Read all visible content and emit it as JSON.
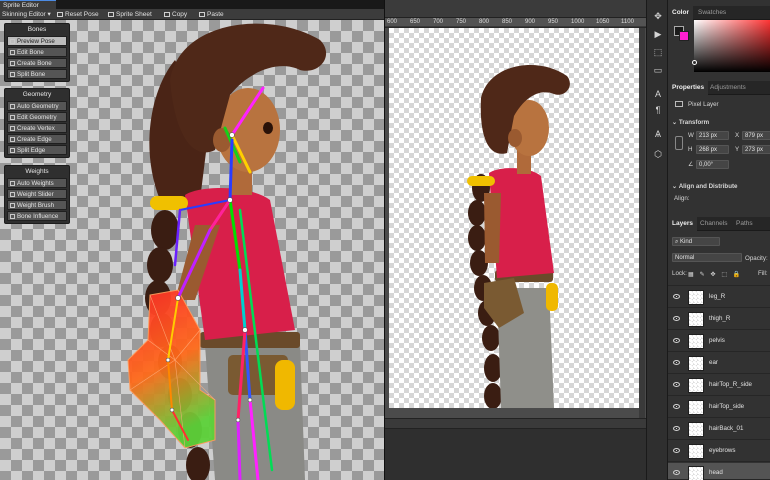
{
  "unity": {
    "window_tab": "Sprite Editor",
    "toolbar": {
      "mode_dropdown": "Skinning Editor",
      "reset_pose": "Reset Pose",
      "sprite_sheet": "Sprite Sheet",
      "copy": "Copy",
      "paste": "Paste"
    },
    "panels": [
      {
        "title": "Bones",
        "buttons": [
          "Preview Pose",
          "Edit Bone",
          "Create Bone",
          "Split Bone"
        ],
        "active": 0
      },
      {
        "title": "Geometry",
        "buttons": [
          "Auto Geometry",
          "Edit Geometry",
          "Create Vertex",
          "Create Edge",
          "Split Edge"
        ],
        "active": -1
      },
      {
        "title": "Weights",
        "buttons": [
          "Auto Weights",
          "Weight Slider",
          "Weight Brush",
          "Bone Influence"
        ],
        "active": -1
      }
    ]
  },
  "ps": {
    "ruler_ticks": [
      "600",
      "650",
      "700",
      "750",
      "800",
      "850",
      "900",
      "950",
      "1000",
      "1050",
      "1100"
    ],
    "tools": [
      "✥",
      "▶",
      "⬚",
      "▭",
      "A",
      "¶",
      "⊞",
      "Ѧ",
      "⬡"
    ],
    "color_tabs": [
      "Color",
      "Swatches"
    ],
    "fg_color": "#1a1a1a",
    "bg_color": "#ff1fd0",
    "properties_tabs": [
      "Properties",
      "Adjustments"
    ],
    "layer_kind": "Pixel Layer",
    "transform_title": "Transform",
    "transform": {
      "w": "213 px",
      "h": "268 px",
      "x": "879 px",
      "y": "273 px",
      "angle": "0,00°"
    },
    "align_title": "Align and Distribute",
    "align_label": "Align:",
    "layers_tabs": [
      "Layers",
      "Channels",
      "Paths"
    ],
    "kind_filter": "Kind",
    "blend_mode": "Normal",
    "opacity_label": "Opacity:",
    "lock_label": "Lock:",
    "fill_label": "Fill:",
    "layers": [
      "leg_R",
      "thigh_R",
      "pelvis",
      "ear",
      "hairTop_R_side",
      "hairTop_side",
      "hairBack_01",
      "eyebrows",
      "head"
    ]
  }
}
